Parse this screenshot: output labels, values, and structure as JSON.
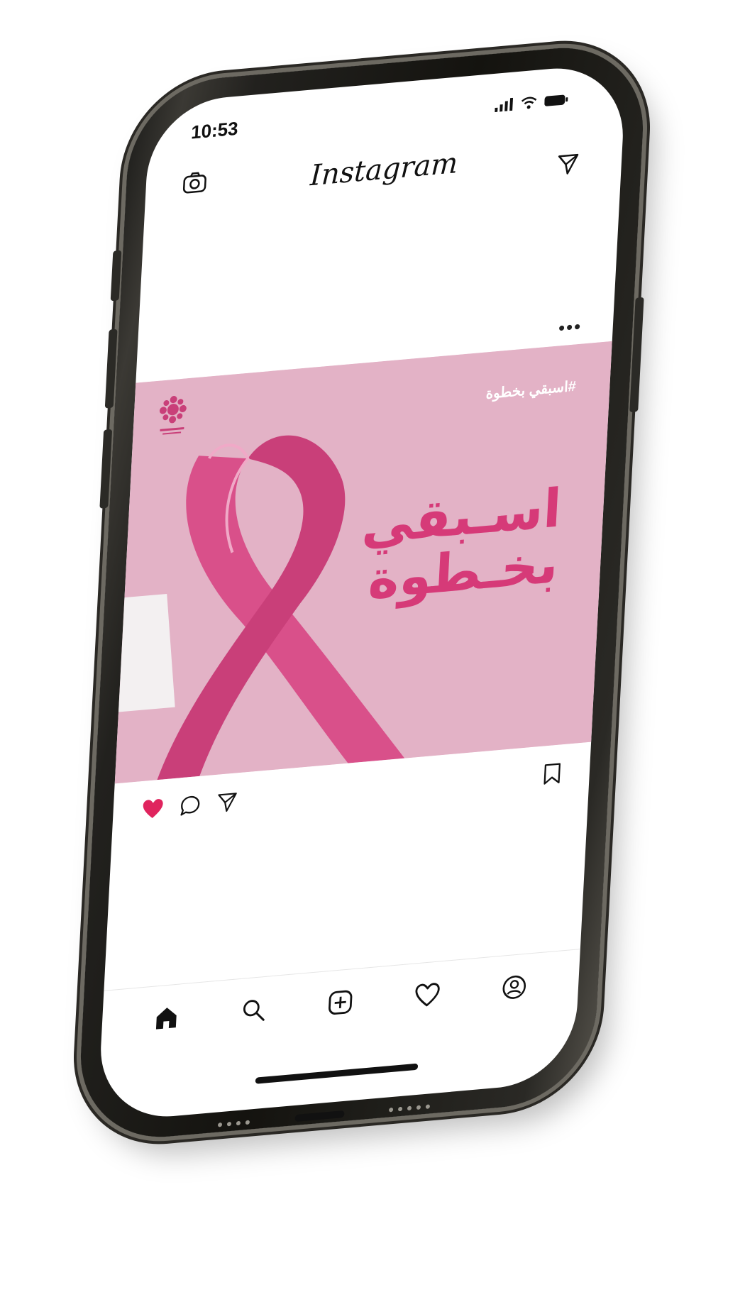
{
  "status": {
    "time": "10:53"
  },
  "header": {
    "brand": "Instagram"
  },
  "post": {
    "headline_line1": "اسـبقي",
    "headline_line2": "بخـطوة",
    "hashtag": "#اسبقي بخطوة",
    "liked": true,
    "colors": {
      "background": "#e3b2c6",
      "accent": "#d63a78",
      "like": "#e0245e"
    }
  },
  "icons": {
    "camera": "camera-icon",
    "direct": "paper-plane-icon",
    "more": "more-dots-icon",
    "like": "heart-filled-icon",
    "comment": "comment-icon",
    "share": "paper-plane-icon",
    "save": "bookmark-icon",
    "home": "home-icon",
    "search": "search-icon",
    "create": "plus-square-icon",
    "activity": "heart-icon",
    "profile": "profile-icon"
  }
}
